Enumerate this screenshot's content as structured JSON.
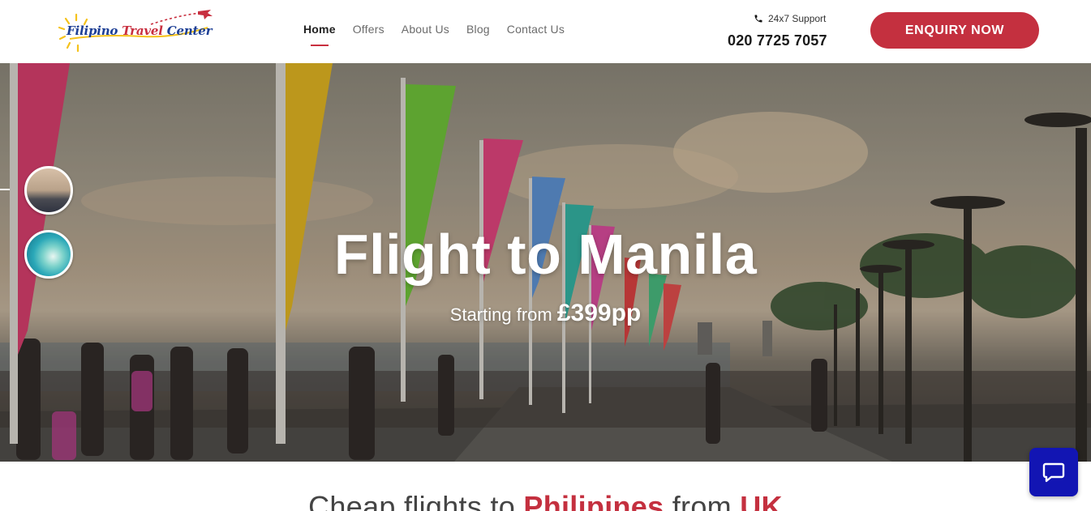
{
  "header": {
    "logo": {
      "part1": "Filipino",
      "part2": "Travel",
      "part3": "Center"
    },
    "nav": [
      {
        "label": "Home",
        "active": true
      },
      {
        "label": "Offers",
        "active": false
      },
      {
        "label": "About Us",
        "active": false
      },
      {
        "label": "Blog",
        "active": false
      },
      {
        "label": "Contact Us",
        "active": false
      }
    ],
    "support": {
      "label": "24x7 Support",
      "icon": "phone-icon",
      "phone": "020 7725 7057"
    },
    "enquiry_label": "ENQUIRY NOW"
  },
  "hero": {
    "title": "Flight to Manila",
    "subtitle_prefix": "Starting from ",
    "price": "£399pp"
  },
  "section": {
    "heading_part1": "Cheap flights to ",
    "heading_highlight1": "Philipines",
    "heading_part2": " from ",
    "heading_highlight2": "UK"
  },
  "chat": {
    "icon": "chat-bubble-icon"
  },
  "colors": {
    "brand_red": "#c4303f",
    "brand_blue": "#1d3f95",
    "chat_blue": "#1215b3"
  }
}
